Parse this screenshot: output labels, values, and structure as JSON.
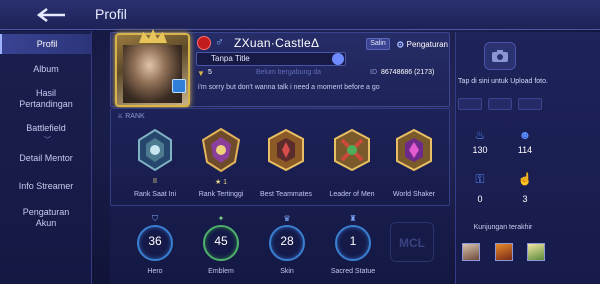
{
  "header": {
    "title": "Profil"
  },
  "sidebar": {
    "items": [
      {
        "label": "Profil"
      },
      {
        "label": "Album"
      },
      {
        "label": "Hasil Pertandingan"
      },
      {
        "label": "Battlefield"
      },
      {
        "label": "Detail Mentor"
      },
      {
        "label": "Info Streamer"
      },
      {
        "label": "Pengaturan Akun"
      }
    ]
  },
  "profile": {
    "name": "ZXuan·CastleΔ",
    "copy_label": "Salin",
    "settings_label": "Pengaturan",
    "title": "Tanpa Title",
    "level": "5",
    "joined": "Belum bergabung da",
    "id_label": "ID",
    "id": "86748686 (2173)",
    "bio": "i'm sorry but don't wanna talk i need a moment before a go"
  },
  "rank": {
    "header": "RANK",
    "medals": [
      {
        "label": "Rank Saat Ini",
        "sub": "II"
      },
      {
        "label": "Rank Tertinggi",
        "sub": "★ 1"
      },
      {
        "label": "Best Teammates"
      },
      {
        "label": "Leader of Men"
      },
      {
        "label": "World Shaker"
      }
    ]
  },
  "stats": [
    {
      "label": "Hero",
      "value": "36"
    },
    {
      "label": "Emblem",
      "value": "45"
    },
    {
      "label": "Skin",
      "value": "28"
    },
    {
      "label": "Sacred Statue",
      "value": "1"
    }
  ],
  "stats_logo": "MCL",
  "right": {
    "upload_text": "Tap di sini untuk Upload foto.",
    "social": [
      {
        "icon": "flame-icon",
        "value": "130"
      },
      {
        "icon": "followers-icon",
        "value": "114"
      },
      {
        "icon": "gift-icon",
        "value": "0"
      },
      {
        "icon": "like-icon",
        "value": "3"
      }
    ],
    "visits_label": "Kunjungan terakhir"
  }
}
